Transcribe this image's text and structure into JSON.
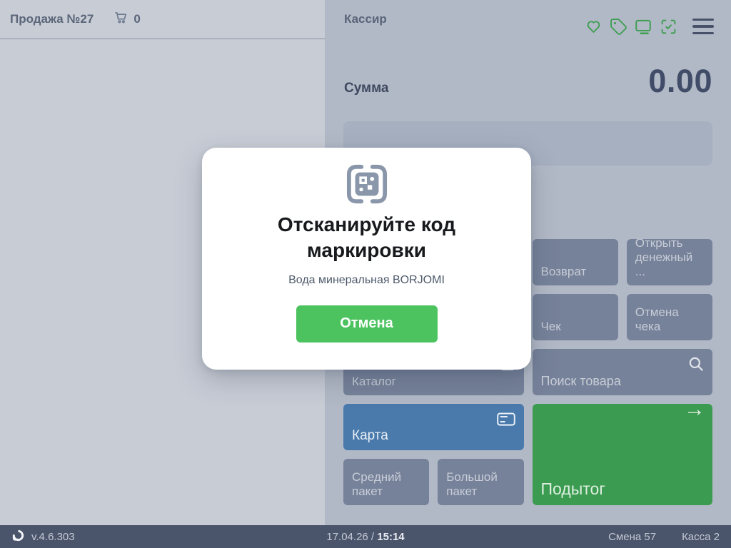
{
  "colors": {
    "left_panel_bg": "#c8ccd5",
    "right_panel_bg": "#b2b9c6",
    "button_gray": "#76829a",
    "card_blue": "#4a7aac",
    "subtotal_green": "#3b9b50",
    "cancel_button_green": "#4cc35f",
    "top_icon_green": "#3f9e53",
    "status_bar_bg": "#4a546b",
    "sum_text": "#414d68"
  },
  "left_panel": {
    "title": "Продажа №27",
    "cart_count": "0"
  },
  "right_panel": {
    "cashier_label": "Кассир",
    "sum_label": "Сумма",
    "sum_value": "0.00",
    "buttons": {
      "return": "Возврат",
      "open_drawer": "Открыть денежный ...",
      "receipt": "Чек",
      "cancel_receipt": "Отмена чека",
      "catalog": "Каталог",
      "search": "Поиск товара",
      "card": "Карта",
      "subtotal": "Подытог",
      "medium_bag": "Средний пакет",
      "big_bag": "Большой пакет"
    },
    "icons": {
      "top_bar": [
        "heart-icon",
        "tag-icon",
        "monitor-icon",
        "scan-check-icon",
        "menu-icon"
      ],
      "subtotal_arrow": "→"
    }
  },
  "modal": {
    "icon": "qr-scan-icon",
    "title": "Отсканируйте код маркировки",
    "subtitle": "Вода минеральная BORJOMI",
    "cancel_label": "Отмена"
  },
  "status_bar": {
    "version": "v.4.6.303",
    "date": "17.04.26",
    "separator": "/",
    "time": "15:14",
    "shift": "Смена 57",
    "register": "Касса 2"
  }
}
